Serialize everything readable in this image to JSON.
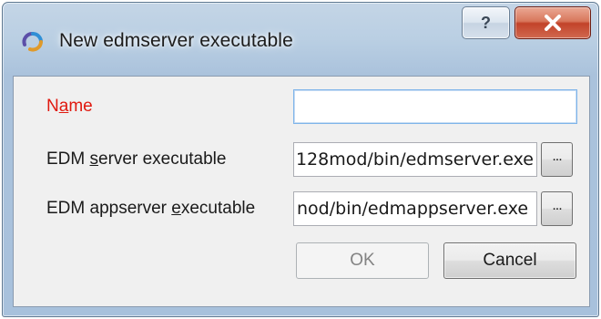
{
  "window": {
    "title": "New edmserver executable",
    "help_glyph": "?",
    "icon": "app-logo-icon",
    "close_icon": "close-icon"
  },
  "form": {
    "name": {
      "label_pre": "N",
      "label_mnemonic": "a",
      "label_post": "me",
      "value": "",
      "label_color": "#e0190f"
    },
    "server_exe": {
      "label_pre": "EDM ",
      "label_mnemonic": "s",
      "label_post": "erver executable",
      "value": "128mod/bin/edmserver.exe",
      "browse_label": "..."
    },
    "appserver_exe": {
      "label_pre": "EDM appserver ",
      "label_mnemonic": "e",
      "label_post": "xecutable",
      "value": "nod/bin/edmappserver.exe",
      "browse_label": "..."
    }
  },
  "buttons": {
    "ok": "OK",
    "cancel": "Cancel"
  }
}
